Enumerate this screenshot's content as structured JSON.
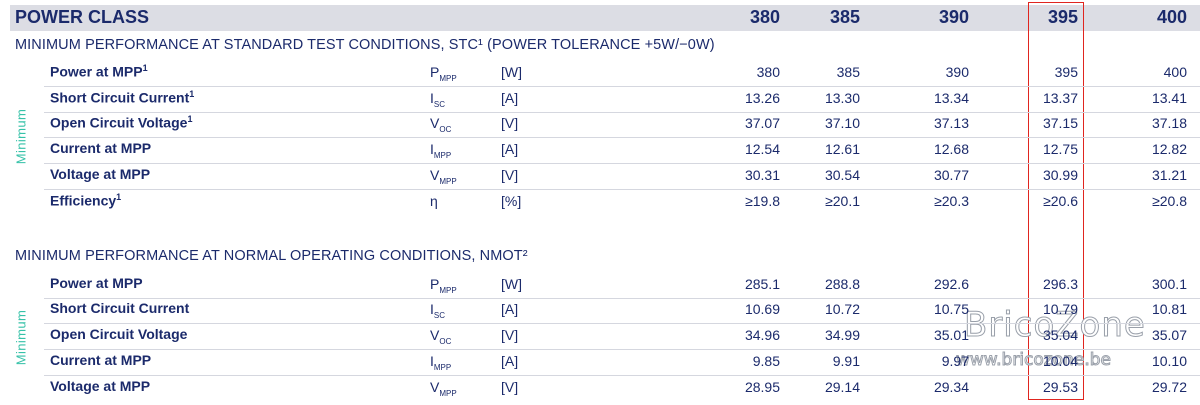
{
  "header": {
    "title": "POWER CLASS",
    "classes": [
      "380",
      "385",
      "390",
      "395",
      "400"
    ]
  },
  "stc": {
    "title": "MINIMUM PERFORMANCE AT STANDARD TEST CONDITIONS, STC¹ (POWER TOLERANCE +5W/−0W)",
    "side_label": "Minimum",
    "rows": [
      {
        "name": "Power at MPP",
        "sup": "1",
        "sym": "P",
        "sub": "MPP",
        "unit": "[W]",
        "values": [
          "380",
          "385",
          "390",
          "395",
          "400"
        ]
      },
      {
        "name": "Short Circuit Current",
        "sup": "1",
        "sym": "I",
        "sub": "SC",
        "unit": "[A]",
        "values": [
          "13.26",
          "13.30",
          "13.34",
          "13.37",
          "13.41"
        ]
      },
      {
        "name": "Open Circuit Voltage",
        "sup": "1",
        "sym": "V",
        "sub": "OC",
        "unit": "[V]",
        "values": [
          "37.07",
          "37.10",
          "37.13",
          "37.15",
          "37.18"
        ]
      },
      {
        "name": "Current at MPP",
        "sup": "",
        "sym": "I",
        "sub": "MPP",
        "unit": "[A]",
        "values": [
          "12.54",
          "12.61",
          "12.68",
          "12.75",
          "12.82"
        ]
      },
      {
        "name": "Voltage at MPP",
        "sup": "",
        "sym": "V",
        "sub": "MPP",
        "unit": "[V]",
        "values": [
          "30.31",
          "30.54",
          "30.77",
          "30.99",
          "31.21"
        ]
      },
      {
        "name": "Efficiency",
        "sup": "1",
        "sym": "η",
        "sub": "",
        "unit": "[%]",
        "values": [
          "≥19.8",
          "≥20.1",
          "≥20.3",
          "≥20.6",
          "≥20.8"
        ]
      }
    ]
  },
  "nmot": {
    "title": "MINIMUM PERFORMANCE AT NORMAL OPERATING CONDITIONS, NMOT²",
    "side_label": "Minimum",
    "rows": [
      {
        "name": "Power at MPP",
        "sup": "",
        "sym": "P",
        "sub": "MPP",
        "unit": "[W]",
        "values": [
          "285.1",
          "288.8",
          "292.6",
          "296.3",
          "300.1"
        ]
      },
      {
        "name": "Short Circuit Current",
        "sup": "",
        "sym": "I",
        "sub": "SC",
        "unit": "[A]",
        "values": [
          "10.69",
          "10.72",
          "10.75",
          "10.79",
          "10.81"
        ]
      },
      {
        "name": "Open Circuit Voltage",
        "sup": "",
        "sym": "V",
        "sub": "OC",
        "unit": "[V]",
        "values": [
          "34.96",
          "34.99",
          "35.01",
          "35.04",
          "35.07"
        ]
      },
      {
        "name": "Current at MPP",
        "sup": "",
        "sym": "I",
        "sub": "MPP",
        "unit": "[A]",
        "values": [
          "9.85",
          "9.91",
          "9.97",
          "10.04",
          "10.10"
        ]
      },
      {
        "name": "Voltage at MPP",
        "sup": "",
        "sym": "V",
        "sub": "MPP",
        "unit": "[V]",
        "values": [
          "28.95",
          "29.14",
          "29.34",
          "29.53",
          "29.72"
        ]
      }
    ]
  },
  "watermark": {
    "brand": "BricoZone",
    "url": "www.bricozone.be"
  }
}
